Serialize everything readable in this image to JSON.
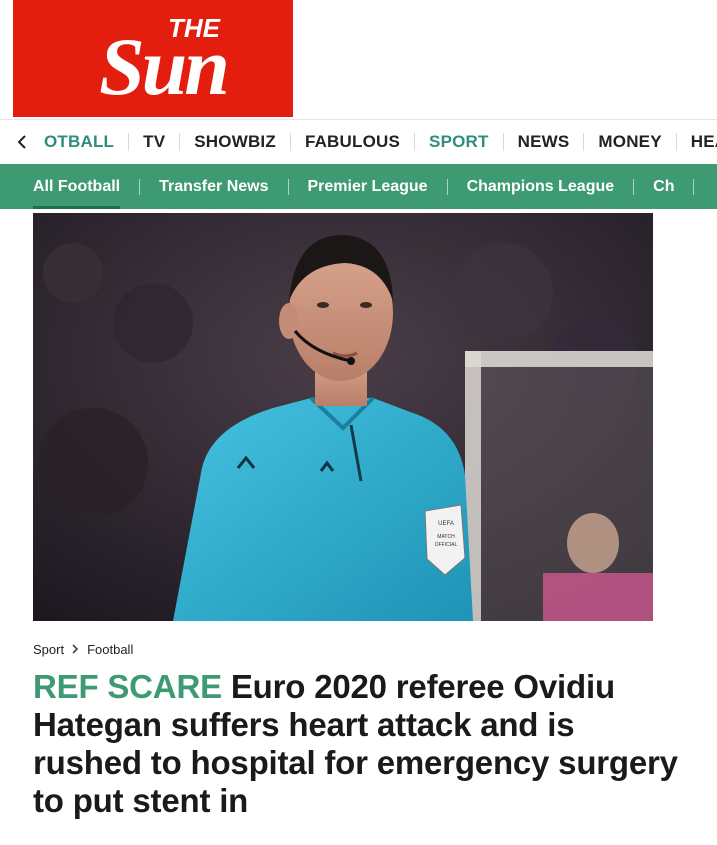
{
  "brand": {
    "name_top": "THE",
    "name_main": "Sun",
    "color": "#e31e0f"
  },
  "topnav": {
    "back_icon": "chevron-left-icon",
    "items": [
      "OTBALL",
      "TV",
      "SHOWBIZ",
      "FABULOUS",
      "SPORT",
      "NEWS",
      "MONEY",
      "HEALTH"
    ]
  },
  "subnav": {
    "items": [
      "All Football",
      "Transfer News",
      "Premier League",
      "Champions League",
      "Ch"
    ],
    "accent": "#3e9a73"
  },
  "article": {
    "breadcrumb": [
      "Sport",
      "Football"
    ],
    "kicker": "REF SCARE",
    "headline": "Euro 2020 referee Ovidiu Hategan suffers heart attack and is rushed to hospital for emergency surgery to put stent in",
    "badge_text": [
      "UEFA",
      "MATCH",
      "OFFICIAL"
    ]
  }
}
